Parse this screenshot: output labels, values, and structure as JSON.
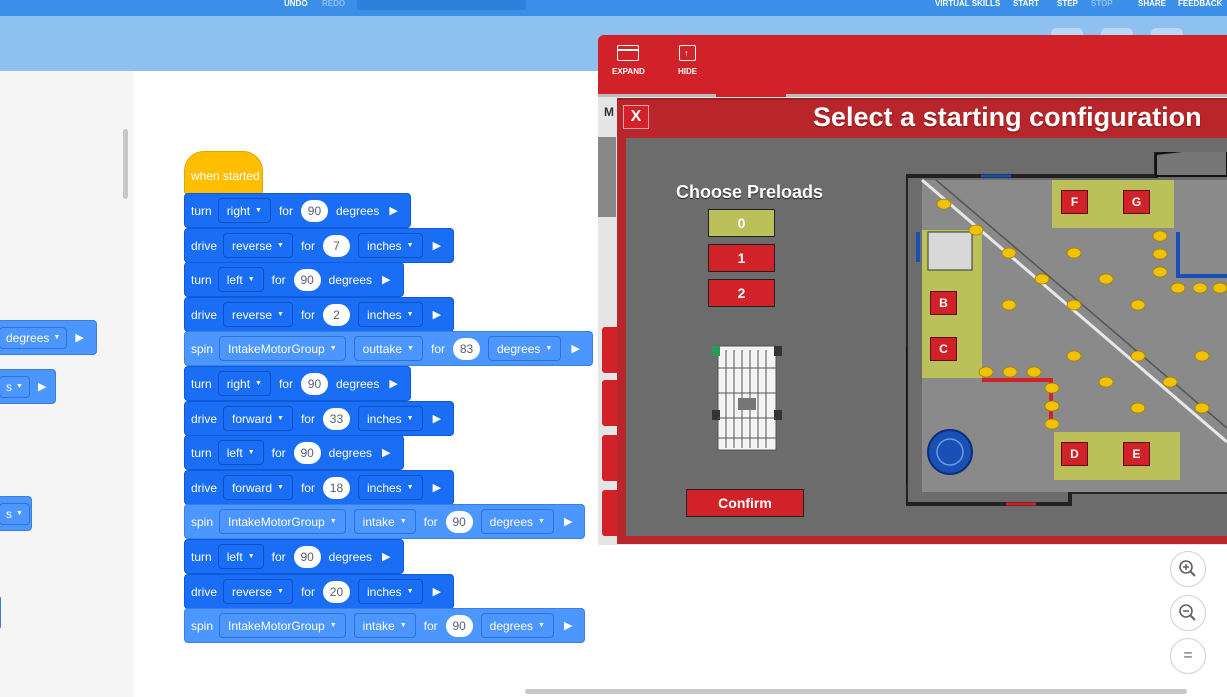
{
  "topbar": {
    "undo": "UNDO",
    "redo": "REDO",
    "virtual_skills": "VIRTUAL SKILLS",
    "start": "START",
    "step": "STEP",
    "stop": "STOP",
    "share": "SHARE",
    "feedback": "FEEDBACK"
  },
  "toolbox": {
    "blocks": [
      {
        "dropdown": "degrees"
      },
      {
        "dropdown": "s"
      },
      {
        "dropdown": "s"
      }
    ]
  },
  "program": {
    "hat": "when started",
    "blocks": [
      {
        "kw": "turn",
        "dir": "right",
        "for": "for",
        "value": "90",
        "unit": "degrees",
        "unit_dd": false,
        "style": "blue"
      },
      {
        "kw": "drive",
        "dir": "reverse",
        "for": "for",
        "value": "7",
        "unit": "inches",
        "unit_dd": true,
        "style": "blue"
      },
      {
        "kw": "turn",
        "dir": "left",
        "for": "for",
        "value": "90",
        "unit": "degrees",
        "unit_dd": false,
        "style": "blue"
      },
      {
        "kw": "drive",
        "dir": "reverse",
        "for": "for",
        "value": "2",
        "unit": "inches",
        "unit_dd": true,
        "style": "blue"
      },
      {
        "kw": "spin",
        "group": "IntakeMotorGroup",
        "dir": "outtake",
        "for": "for",
        "value": "83",
        "unit": "degrees",
        "unit_dd": true,
        "style": "light"
      },
      {
        "kw": "turn",
        "dir": "right",
        "for": "for",
        "value": "90",
        "unit": "degrees",
        "unit_dd": false,
        "style": "blue"
      },
      {
        "kw": "drive",
        "dir": "forward",
        "for": "for",
        "value": "33",
        "unit": "inches",
        "unit_dd": true,
        "style": "blue"
      },
      {
        "kw": "turn",
        "dir": "left",
        "for": "for",
        "value": "90",
        "unit": "degrees",
        "unit_dd": false,
        "style": "blue"
      },
      {
        "kw": "drive",
        "dir": "forward",
        "for": "for",
        "value": "18",
        "unit": "inches",
        "unit_dd": true,
        "style": "blue"
      },
      {
        "kw": "spin",
        "group": "IntakeMotorGroup",
        "dir": "intake",
        "for": "for",
        "value": "90",
        "unit": "degrees",
        "unit_dd": true,
        "style": "light"
      },
      {
        "kw": "turn",
        "dir": "left",
        "for": "for",
        "value": "90",
        "unit": "degrees",
        "unit_dd": false,
        "style": "blue"
      },
      {
        "kw": "drive",
        "dir": "reverse",
        "for": "for",
        "value": "20",
        "unit": "inches",
        "unit_dd": true,
        "style": "blue"
      },
      {
        "kw": "spin",
        "group": "IntakeMotorGroup",
        "dir": "intake",
        "for": "for",
        "value": "90",
        "unit": "degrees",
        "unit_dd": true,
        "style": "light"
      }
    ]
  },
  "panel": {
    "expand": "EXPAND",
    "hide": "HIDE",
    "m_label": "M"
  },
  "modal": {
    "title": "Select a starting configuration",
    "close": "X",
    "choose_preloads": "Choose Preloads",
    "preloads": [
      "0",
      "1",
      "2"
    ],
    "selected_preload": "0",
    "confirm": "Confirm",
    "tiles": [
      "F",
      "G",
      "B",
      "C",
      "D",
      "E"
    ]
  },
  "zoom": {
    "in": "+",
    "out": "−",
    "reset": "="
  },
  "colors": {
    "topbar": "#3b8fe8",
    "block_blue": "#1a6ef5",
    "block_light": "#4c97ff",
    "hat": "#ffbf00",
    "panel_red": "#d1222a",
    "preload_selected": "#bcc05a",
    "field_zone": "#bcc05a"
  }
}
